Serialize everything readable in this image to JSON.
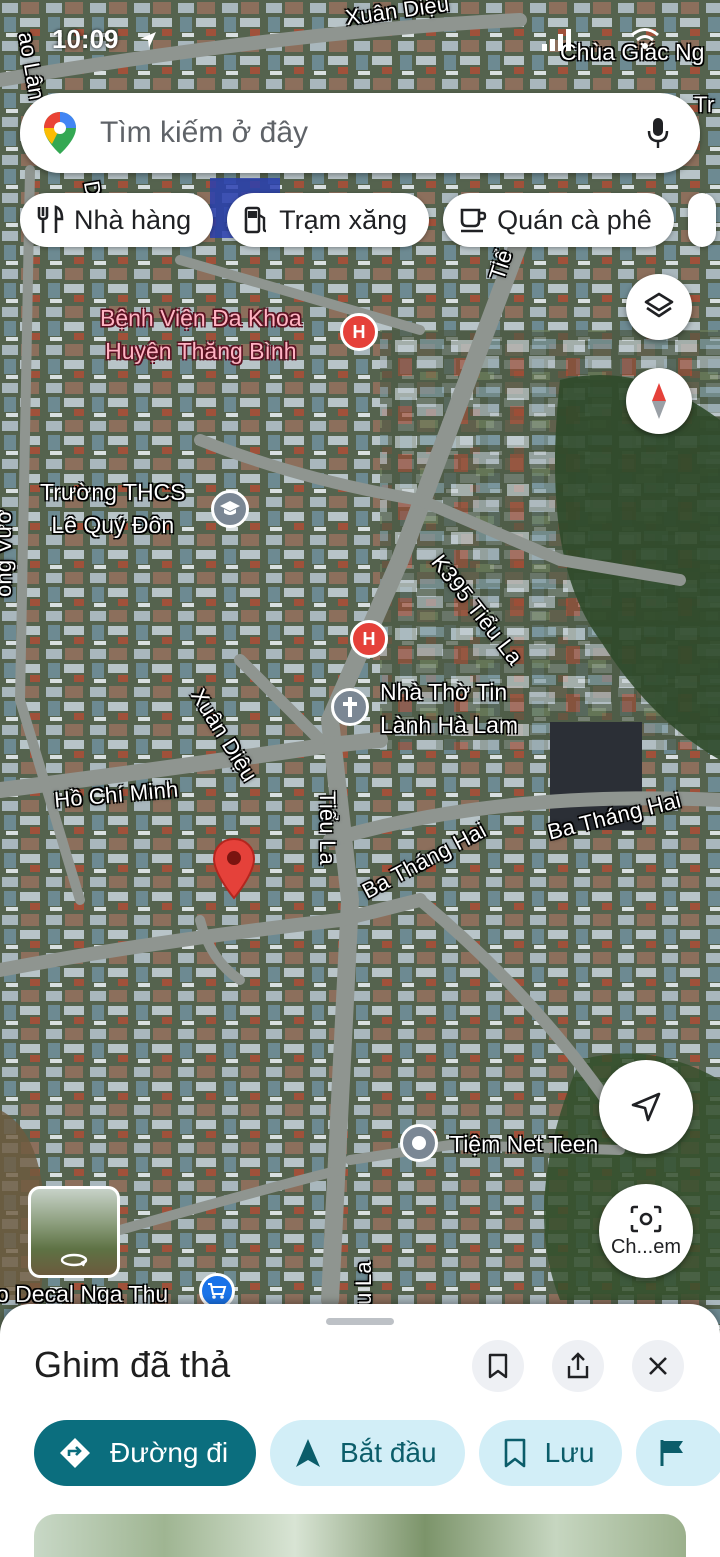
{
  "status_bar": {
    "time": "10:09"
  },
  "search": {
    "placeholder": "Tìm kiếm ở đây"
  },
  "chips": [
    {
      "label": "Nhà hàng",
      "icon": "restaurant-icon"
    },
    {
      "label": "Trạm xăng",
      "icon": "gas-station-icon"
    },
    {
      "label": "Quán cà phê",
      "icon": "coffee-icon"
    }
  ],
  "map": {
    "roads": {
      "xuan_dieu_top": "Xuân Diệu",
      "xuan_dieu_mid": "Xuân Diệu",
      "k395": "K395 Tiểu La",
      "ho_chi_minh": "Hồ Chí Minh",
      "tieu_la": "Tiểu La",
      "tieu_la_bottom": "u La",
      "ba_thang_hai_1": "Ba Tháng Hai",
      "ba_thang_hai_2": "Ba Tháng Hai",
      "top_right": "Tr",
      "top_left": "ao Lân",
      "left_edge": "ong Vươ",
      "top_partial_d": "D",
      "tieu_top": "Tiể"
    },
    "pois": {
      "hospital": {
        "line1": "Bệnh Viện Đa Khoa",
        "line2": "Huyện Thăng Bình"
      },
      "school": {
        "line1": "Trường THCS",
        "line2": "Lê Quý Đôn"
      },
      "church": {
        "line1": "Nhà Thờ Tin",
        "line2": "Lành Hà Lam"
      },
      "net_cafe": "Tiệm Net Teen",
      "decal": "o Decal Nga Thu",
      "pagoda": "Chùa Giác Ng"
    }
  },
  "controls": {
    "layers": "layers-icon",
    "compass": "compass-icon",
    "my_location": "navigation-arrow-icon",
    "lens_label": "Ch...em"
  },
  "sheet": {
    "title": "Ghim đã thả",
    "actions": {
      "directions": "Đường đi",
      "start": "Bắt đầu",
      "save": "Lưu"
    }
  },
  "colors": {
    "accent_teal": "#0b6e7e",
    "accent_light": "#d2eef7",
    "pin_red": "#e5413a",
    "poi_pink": "#ffb3c2"
  }
}
